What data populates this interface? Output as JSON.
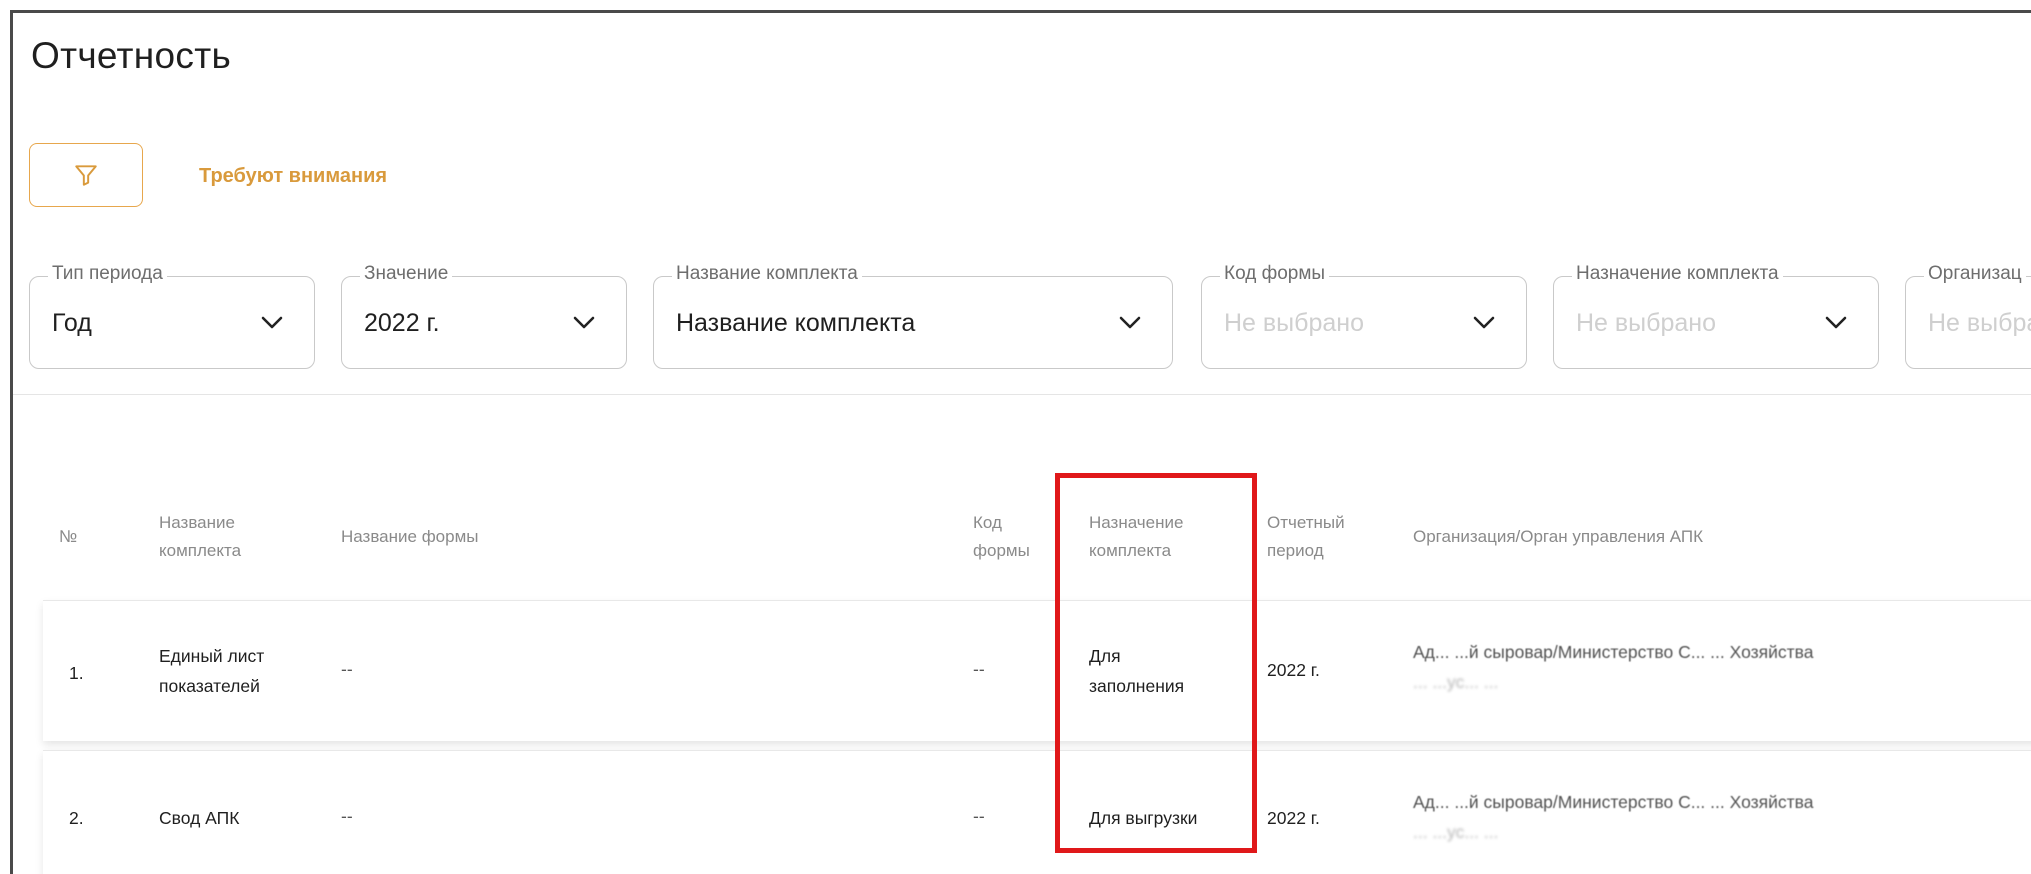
{
  "page": {
    "title": "Отчетность"
  },
  "toolbar": {
    "filter_icon": "funnel-icon",
    "attention_label": "Требуют внимания"
  },
  "filters": [
    {
      "label": "Тип периода",
      "value": "Год",
      "placeholder": false
    },
    {
      "label": "Значение",
      "value": "2022 г.",
      "placeholder": false
    },
    {
      "label": "Название комплекта",
      "value": "Название комплекта",
      "placeholder": false
    },
    {
      "label": "Код формы",
      "value": "Не выбрано",
      "placeholder": true
    },
    {
      "label": "Назначение комплекта",
      "value": "Не выбрано",
      "placeholder": true
    },
    {
      "label": "Организац",
      "value": "Не выбра",
      "placeholder": true
    }
  ],
  "table": {
    "headers": {
      "num": "№",
      "kit_name_1": "Название",
      "kit_name_2": "комплекта",
      "form_name": "Название формы",
      "form_code_1": "Код",
      "form_code_2": "формы",
      "purpose_1": "Назначение",
      "purpose_2": "комплекта",
      "period_1": "Отчетный",
      "period_2": "период",
      "org": "Организация/Орган управления АПК"
    },
    "rows": [
      {
        "num": "1.",
        "kit_name_1": "Единый лист",
        "kit_name_2": "показателей",
        "form_name": "--",
        "form_code": "--",
        "purpose_1": "Для",
        "purpose_2": "заполнения",
        "period": "2022 г.",
        "org_1": "Ад... ...й сыровар/Министерство С... ... Хозяйства",
        "org_2": "... ...ус... ..."
      },
      {
        "num": "2.",
        "kit_name_1": "Свод АПК",
        "kit_name_2": "",
        "form_name": "--",
        "form_code": "--",
        "purpose_1": "Для выгрузки",
        "purpose_2": "",
        "period": "2022 г.",
        "org_1": "Ад... ...й сыровар/Министерство С... ... Хозяйства",
        "org_2": "... ...ус... ..."
      }
    ]
  },
  "colors": {
    "accent": "#e7a74d",
    "highlight": "#e0181a"
  }
}
